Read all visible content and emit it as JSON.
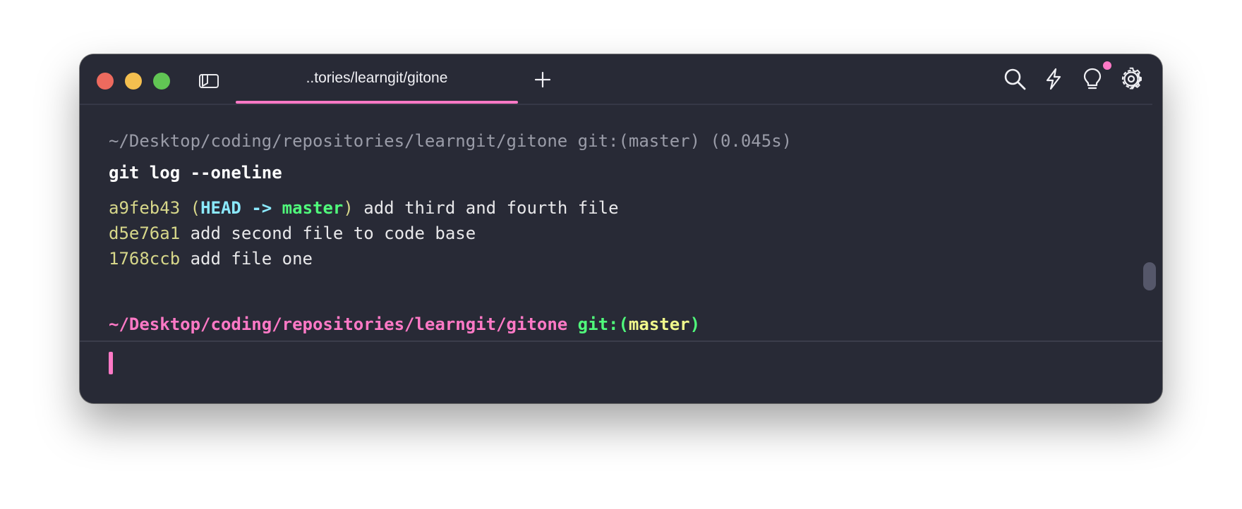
{
  "titlebar": {
    "tab_title": "..tories/learngit/gitone",
    "new_tab_label": "+",
    "icons": [
      "panel-toggle-icon",
      "plus-icon",
      "search-icon",
      "bolt-icon",
      "lightbulb-icon",
      "gear-icon"
    ],
    "notification_dot": true
  },
  "block": {
    "meta": "~/Desktop/coding/repositories/learngit/gitone git:(master) (0.045s)",
    "command": "git log --oneline",
    "output": [
      {
        "hash": "a9feb43",
        "paren_open": "(",
        "head": "HEAD",
        "arrow": "->",
        "branch": "master",
        "paren_close": ")",
        "message": "add third and fourth file"
      },
      {
        "hash": "d5e76a1",
        "message": "add second file to code base"
      },
      {
        "hash": "1768ccb",
        "message": "add file one"
      }
    ]
  },
  "prompt": {
    "path": "~/Desktop/coding/repositories/learngit/gitone",
    "git_prefix": "git:(",
    "branch": "master",
    "git_suffix": ")"
  },
  "colors": {
    "background": "#282a36",
    "accent": "#ff79c6",
    "hash": "#d7d78a",
    "head": "#8be9fd",
    "branch_green": "#50fa7b",
    "branch_yellow": "#f1fa8c"
  }
}
